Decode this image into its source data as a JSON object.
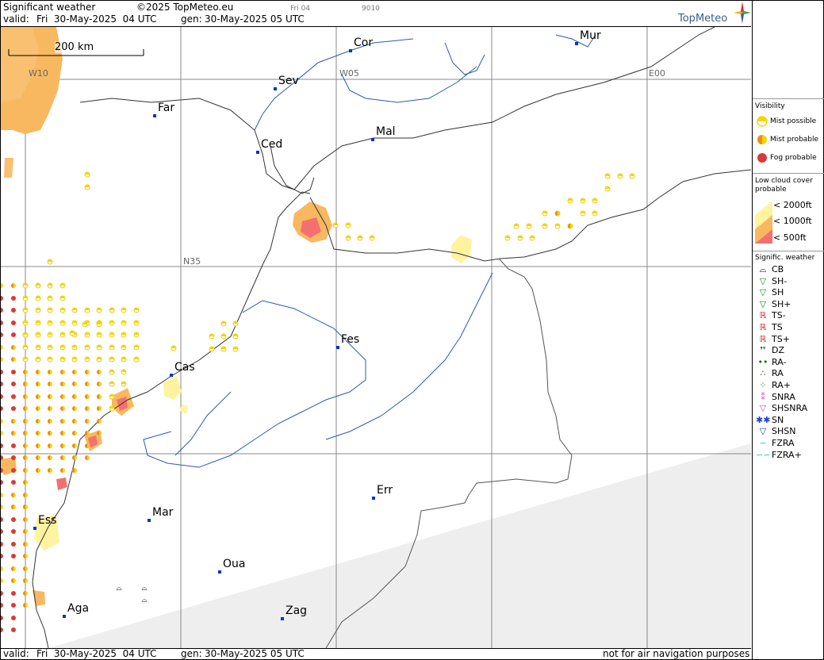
{
  "header": {
    "product": "Significant weather",
    "copyright": "©2025 TopMeteo.eu",
    "valid_label": "valid:",
    "valid_value": "Fri  30-May-2025  04 UTC",
    "gen_label": "gen:",
    "gen_value": "30-May-2025 05 UTC",
    "tiny_left": "Fri 04",
    "tiny_right": "9010"
  },
  "logo": {
    "text": "TopMeteo"
  },
  "scale_bar": {
    "label": "200 km"
  },
  "grid_labels": [
    "W10",
    "W05",
    "E00",
    "N35"
  ],
  "cities": [
    {
      "id": "cor",
      "name": "Cor"
    },
    {
      "id": "mur",
      "name": "Mur"
    },
    {
      "id": "sev",
      "name": "Sev"
    },
    {
      "id": "far",
      "name": "Far"
    },
    {
      "id": "mal",
      "name": "Mal"
    },
    {
      "id": "ced",
      "name": "Ced"
    },
    {
      "id": "fes",
      "name": "Fes"
    },
    {
      "id": "cas",
      "name": "Cas"
    },
    {
      "id": "err",
      "name": "Err"
    },
    {
      "id": "mar",
      "name": "Mar"
    },
    {
      "id": "ess",
      "name": "Ess"
    },
    {
      "id": "oua",
      "name": "Oua"
    },
    {
      "id": "aga",
      "name": "Aga"
    },
    {
      "id": "zag",
      "name": "Zag"
    }
  ],
  "legend": {
    "visibility": {
      "title": "Visibility",
      "items": [
        {
          "label": "Mist possible",
          "color": "#f5d500"
        },
        {
          "label": "Mist probable",
          "color": "#f08a1c"
        },
        {
          "label": "Fog probable",
          "color": "#d93a3a"
        }
      ]
    },
    "low_cloud": {
      "title_line1": "Low cloud cover",
      "title_line2": "probable",
      "items": [
        {
          "label": "< 2000ft",
          "color": "#fff3a0"
        },
        {
          "label": "< 1000ft",
          "color": "#f8b860"
        },
        {
          "label": "<  500ft",
          "color": "#f47070"
        }
      ]
    },
    "signific": {
      "title": "Signific. weather",
      "items": [
        {
          "label": "CB",
          "sym": "⌓",
          "color": "#000"
        },
        {
          "label": "SH-",
          "sym": "▽",
          "color": "#1a8a1a"
        },
        {
          "label": "SH",
          "sym": "▽",
          "color": "#1a8a1a"
        },
        {
          "label": "SH+",
          "sym": "▽",
          "color": "#1a8a1a"
        },
        {
          "label": "TS-",
          "sym": "ℝ",
          "color": "#d02020"
        },
        {
          "label": "TS",
          "sym": "ℝ",
          "color": "#d02020"
        },
        {
          "label": "TS+",
          "sym": "ℝ",
          "color": "#d02020"
        },
        {
          "label": "DZ",
          "sym": "❜❜",
          "color": "#1a6a1a"
        },
        {
          "label": "RA-",
          "sym": "••",
          "color": "#1a6a1a"
        },
        {
          "label": "RA",
          "sym": "∴",
          "color": "#1a6a1a"
        },
        {
          "label": "RA+",
          "sym": "⁘",
          "color": "#1a6a1a"
        },
        {
          "label": "SNRA",
          "sym": "⁑",
          "color": "#d040d0"
        },
        {
          "label": "SHSNRA",
          "sym": "▽",
          "color": "#d040d0"
        },
        {
          "label": "SN",
          "sym": "✱✱",
          "color": "#2040d0"
        },
        {
          "label": "SHSN",
          "sym": "▽",
          "color": "#2040d0"
        },
        {
          "label": "FZRA",
          "sym": "∽",
          "color": "#30c0d0"
        },
        {
          "label": "FZRA+",
          "sym": "∽∽",
          "color": "#30c0d0"
        }
      ]
    }
  },
  "footer": {
    "valid_label": "valid:",
    "valid_value": "Fri  30-May-2025  04 UTC",
    "gen_label": "gen:",
    "gen_value": "30-May-2025 05 UTC",
    "disclaimer": "not for air navigation purposes"
  }
}
